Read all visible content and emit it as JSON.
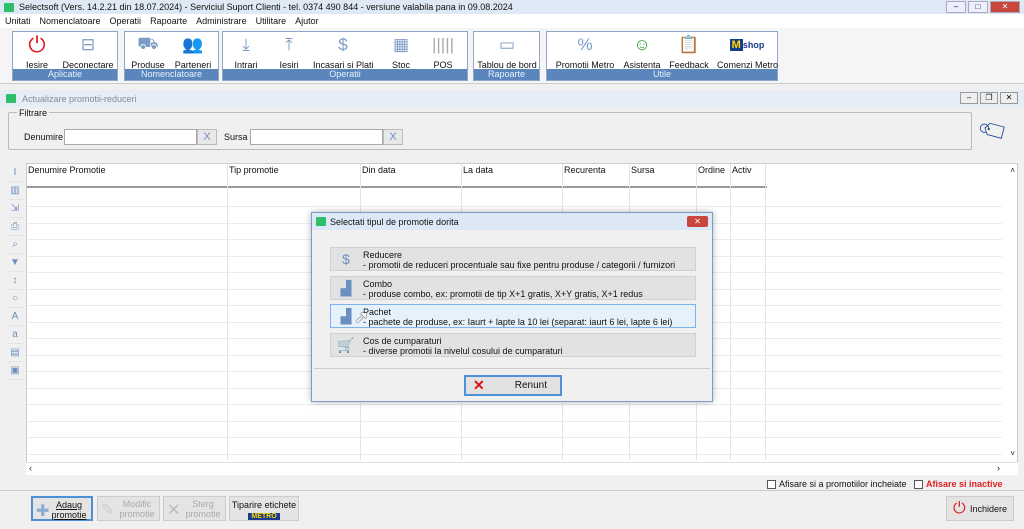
{
  "window": {
    "title": "Selectsoft  (Vers. 14.2.21 din 18.07.2024) - Serviciul Suport Clienti - tel. 0374 490 844  - versiune valabila pana in 09.08.2024"
  },
  "menu": [
    "Unitati",
    "Nomenclatoare",
    "Operatii",
    "Rapoarte",
    "Administrare",
    "Utilitare",
    "Ajutor"
  ],
  "toolbar": {
    "groups": [
      {
        "label": "Aplicatie",
        "buttons": [
          "Iesire",
          "Deconectare"
        ]
      },
      {
        "label": "Nomenclatoare",
        "buttons": [
          "Produse",
          "Parteneri"
        ]
      },
      {
        "label": "Operatii",
        "buttons": [
          "Intrari",
          "Iesiri",
          "Incasari si Plati",
          "Stoc",
          "POS"
        ]
      },
      {
        "label": "Rapoarte",
        "buttons": [
          "Tablou de bord"
        ]
      },
      {
        "label": "Utile",
        "buttons": [
          "Promotii Metro",
          "Asistenta",
          "Feedback",
          "Comenzi Metro"
        ]
      }
    ],
    "mshop": "shop"
  },
  "child": {
    "title": "Actualizare promotii-reduceri"
  },
  "filter": {
    "legend": "Filtrare",
    "denumire_label": "Denumire",
    "denumire_value": "",
    "sursa_label": "Sursa",
    "sursa_value": "",
    "clear": "X"
  },
  "grid": {
    "columns": [
      "Denumire Promotie",
      "Tip promotie",
      "Din data",
      "La data",
      "Recurenta",
      "Sursa",
      "Ordine",
      "Activ"
    ]
  },
  "dialog": {
    "title": "Selectati tipul de promotie dorita",
    "options": [
      {
        "name": "Reducere",
        "desc": " - promotii de reduceri procentuale sau fixe pentru produse / categorii / furnizori"
      },
      {
        "name": "Combo",
        "desc": " - produse combo, ex: promotii de tip X+1 gratis, X+Y gratis, X+1 redus"
      },
      {
        "name": "Pachet",
        "desc": " - pachete de produse, ex: Iaurt + lapte la 10 lei (separat: iaurt 6 lei, lapte 6 lei)"
      },
      {
        "name": "Cos de cumparaturi",
        "desc": " - diverse promotii la nivelul cosului de cumparaturi"
      }
    ],
    "cancel": "Renunt"
  },
  "checks": {
    "incheiate": "Afisare si a promotiilor incheiate",
    "inactive": "Afisare si inactive",
    "inactive_color": "#e02020"
  },
  "bottom": {
    "adaug": "Adaug promotie",
    "modific": "Modific promotie",
    "sterg": "Sterg promotie",
    "tiparire": "Tiparire etichete",
    "metro": "METRO",
    "inchidere": "Inchidere"
  }
}
